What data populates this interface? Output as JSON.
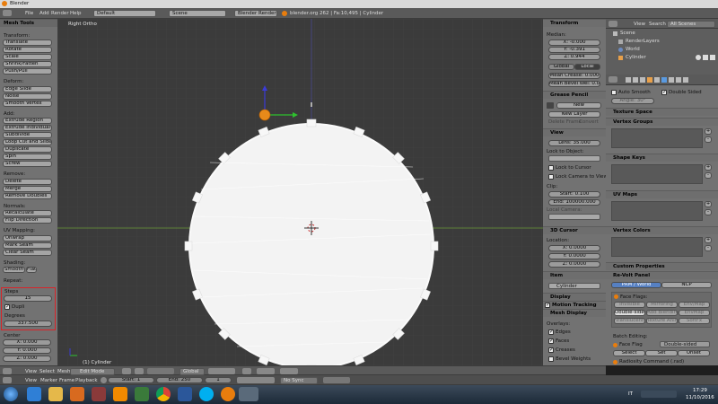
{
  "window": {
    "title": "Blender"
  },
  "topbar": {
    "menus": [
      "File",
      "Add",
      "Render",
      "Help"
    ],
    "layout": "Default",
    "scene": "Scene",
    "engine": "Blender Render",
    "info": "blender.org 262 | Fa:10,495 | Cylinder"
  },
  "toolshelf": {
    "title": "Mesh Tools",
    "transform_label": "Transform:",
    "transform_buttons": [
      "Translate",
      "Rotate",
      "Scale",
      "Shrink/Fatten",
      "Push/Pull"
    ],
    "deform_label": "Deform:",
    "deform_buttons": [
      "Edge Slide",
      "Noise",
      "Smooth Vertex"
    ],
    "add_label": "Add:",
    "add_buttons": [
      "Extrude Region",
      "Extrude Individual",
      "Subdivide",
      "Loop Cut and Slide",
      "Duplicate",
      "Spin",
      "Screw"
    ],
    "remove_label": "Remove:",
    "remove_buttons": [
      "Delete",
      "Merge",
      "Remove Doubles"
    ],
    "normals_label": "Normals:",
    "normals_buttons": [
      "Recalculate",
      "Flip Direction"
    ],
    "uv_label": "UV Mapping:",
    "uv_buttons": [
      "Unwrap",
      "Mark Seam",
      "Clear Seam"
    ],
    "shading_label": "Shading:",
    "shading_smooth": "Smooth",
    "shading_flat": "Flat",
    "repeat_label": "Repeat:",
    "steps_label": "Steps",
    "steps_value": "15",
    "dupli_label": "Dupli",
    "degrees_label": "Degrees",
    "degrees_value": "337.500",
    "center_label": "Center",
    "center_x": "X: 0.000",
    "center_y": "Y: 0.000",
    "center_z": "Z: 0.000"
  },
  "viewport": {
    "view_label": "Right Ortho",
    "object_label": "(1) Cylinder",
    "header_items": [
      "View",
      "Select",
      "Mesh"
    ],
    "mode": "Edit Mode",
    "pivot": "Global"
  },
  "npanel": {
    "transform_title": "Transform",
    "median_label": "Median:",
    "median_x": "X: -0.000",
    "median_y": "Y: -0.391",
    "median_z": "Z: 0.944",
    "global": "Global",
    "local": "Local",
    "mean_crease": "Mean Crease: 0.000",
    "mean_bevel": "Mean Bevel Wei: 0.000",
    "grease_title": "Grease Pencil",
    "grease_new": "New",
    "new_layer": "New Layer",
    "delete_frame": "Delete Frame",
    "convert": "Convert",
    "view_title": "View",
    "lens": "Lens: 35.000",
    "lock_to_object": "Lock to Object:",
    "lock_to_cursor": "Lock to Cursor",
    "lock_camera": "Lock Camera to View",
    "clip_label": "Clip:",
    "clip_start": "Start: 0.100",
    "clip_end": "End: 100000.000",
    "local_camera": "Local Camera:",
    "cursor_title": "3D Cursor",
    "location_label": "Location:",
    "loc_x": "X: 0.0000",
    "loc_y": "Y: 0.0000",
    "loc_z": "Z: 0.0000",
    "item_title": "Item",
    "item_name": "Cylinder",
    "display_title": "Display",
    "motion_tracking": "Motion Tracking",
    "mesh_display_title": "Mesh Display",
    "overlays_label": "Overlays:",
    "edges": "Edges",
    "faces": "Faces",
    "creases": "Creases",
    "bevel_weights": "Bevel Weights"
  },
  "outliner": {
    "view": "View",
    "search": "Search",
    "all_scenes": "All Scenes",
    "items": [
      "Scene",
      "RenderLayers",
      "World",
      "Cylinder"
    ]
  },
  "properties": {
    "auto_smooth": "Auto Smooth",
    "double_sided": "Double Sided",
    "angle": "Angle: 30°",
    "texture_space": "Texture Space",
    "vertex_groups": "Vertex Groups",
    "shape_keys": "Shape Keys",
    "uv_maps": "UV Maps",
    "vertex_colors": "Vertex Colors",
    "custom_props": "Custom Properties",
    "revolt_title": "Re-Volt Panel",
    "tab_prm": "PRM / World",
    "tab_ncp": "NCP",
    "face_flags": "Face Flags:",
    "flags": [
      "Invisible",
      "Mirroring",
      "Double-sided",
      "Add Blending",
      "Translucent",
      "Texture Anim",
      "Env/Map",
      "EnvMap",
      "SoftFx"
    ],
    "batch_editing": "Batch Editing:",
    "face_flag_label": "Face Flag",
    "face_flag_value": "Double-sided",
    "select": "Select",
    "set": "Set",
    "unset": "Unset",
    "radiosity": "Radiosity Command (.rad)"
  },
  "timeline": {
    "items": [
      "View",
      "Marker",
      "Frame",
      "Playback"
    ],
    "start": "Start: 1",
    "end": "End: 250",
    "current": "1",
    "sync": "No Sync"
  },
  "taskbar": {
    "lang": "IT",
    "time": "17:29",
    "date": "11/10/2016"
  },
  "colors": {
    "selection_highlight": "#d8242a",
    "tab_active": "#5680c2",
    "mesh_white": "#f0f0f0"
  }
}
